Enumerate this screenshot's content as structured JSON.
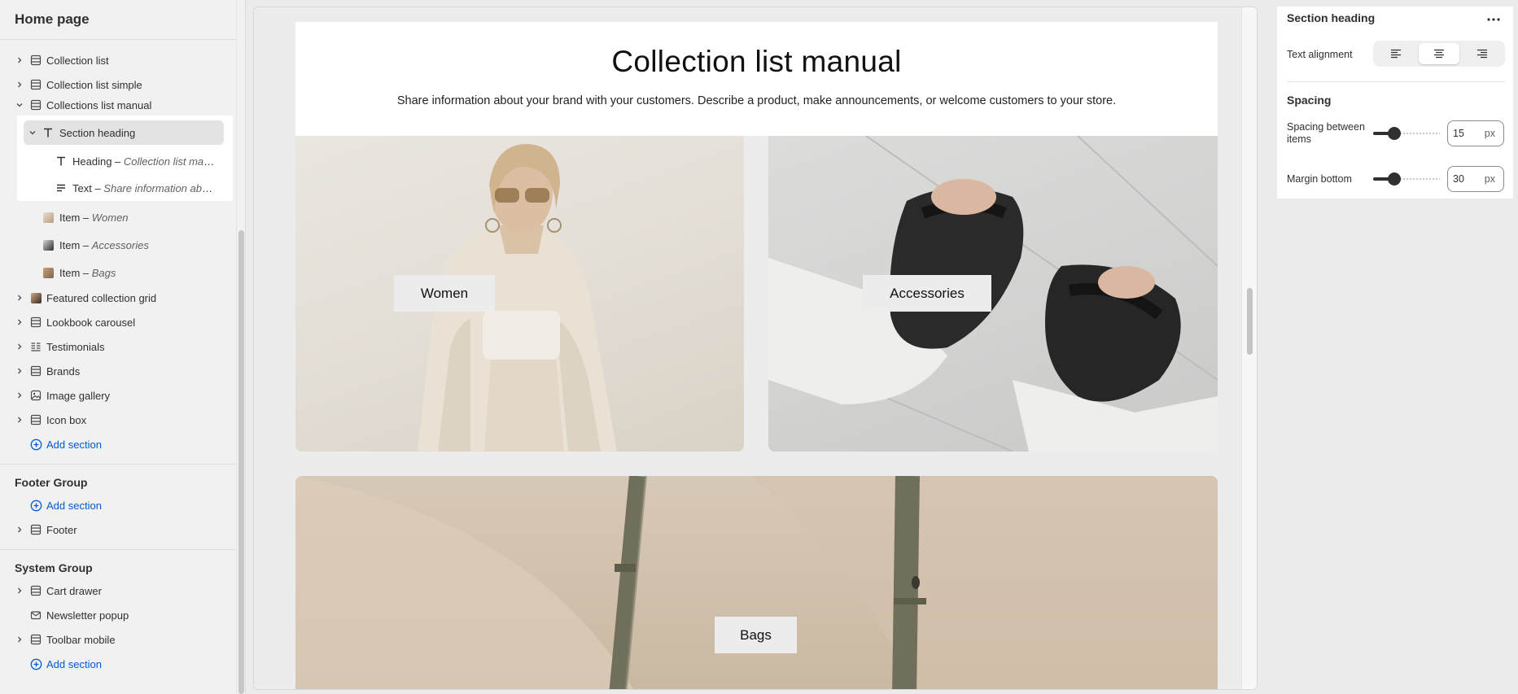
{
  "sidebar": {
    "title": "Home page",
    "sections": [
      {
        "label": "Collection list",
        "icon": "section-icon"
      },
      {
        "label": "Collection list simple",
        "icon": "section-icon"
      },
      {
        "label": "Collections list manual",
        "icon": "section-icon"
      }
    ],
    "blocks": {
      "section_heading": "Section heading",
      "heading_prefix": "Heading – ",
      "heading_value": "Collection list manual",
      "text_prefix": "Text – ",
      "text_value": "Share information about your brand with your customers.",
      "items": [
        {
          "prefix": "Item – ",
          "value": "Women"
        },
        {
          "prefix": "Item – ",
          "value": "Accessories"
        },
        {
          "prefix": "Item – ",
          "value": "Bags"
        }
      ]
    },
    "more_sections": [
      {
        "label": "Featured collection grid",
        "icon": "product-image-icon"
      },
      {
        "label": "Lookbook carousel",
        "icon": "section-icon"
      },
      {
        "label": "Testimonials",
        "icon": "text-columns-icon"
      },
      {
        "label": "Brands",
        "icon": "section-icon"
      },
      {
        "label": "Image gallery",
        "icon": "image-icon"
      },
      {
        "label": "Icon box",
        "icon": "section-icon"
      }
    ],
    "add_section": "Add section",
    "footer_group": {
      "title": "Footer Group",
      "add_section": "Add section",
      "items": [
        {
          "label": "Footer",
          "icon": "section-icon"
        }
      ]
    },
    "system_group": {
      "title": "System Group",
      "add_section": "Add section",
      "items": [
        {
          "label": "Cart drawer",
          "icon": "section-icon"
        },
        {
          "label": "Newsletter popup",
          "icon": "mail-icon"
        },
        {
          "label": "Toolbar mobile",
          "icon": "section-icon"
        }
      ]
    }
  },
  "preview": {
    "heading": "Collection list manual",
    "description": "Share information about your brand with your customers. Describe a product, make announcements, or welcome customers to your store.",
    "tiles": [
      {
        "label": "Women"
      },
      {
        "label": "Accessories"
      },
      {
        "label": "Bags"
      }
    ]
  },
  "settings": {
    "title": "Section heading",
    "text_alignment_label": "Text alignment",
    "text_alignment_value": "center",
    "spacing_title": "Spacing",
    "spacing_between_label": "Spacing between items",
    "spacing_between_value": "15",
    "margin_bottom_label": "Margin bottom",
    "margin_bottom_value": "30",
    "unit": "px"
  },
  "colors": {
    "accent_link": "#005bd3",
    "text": "#303030",
    "selected_bg": "#e3e3e3"
  }
}
